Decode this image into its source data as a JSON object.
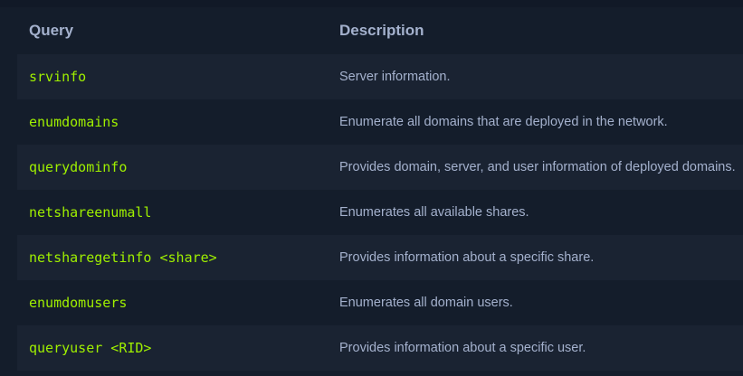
{
  "table": {
    "headers": {
      "query": "Query",
      "description": "Description"
    },
    "rows": [
      {
        "query": "srvinfo",
        "description": "Server information."
      },
      {
        "query": "enumdomains",
        "description": "Enumerate all domains that are deployed in the network."
      },
      {
        "query": "querydominfo",
        "description": "Provides domain, server, and user information of deployed domains."
      },
      {
        "query": "netshareenumall",
        "description": "Enumerates all available shares."
      },
      {
        "query": "netsharegetinfo <share>",
        "description": "Provides information about a specific share."
      },
      {
        "query": "enumdomusers",
        "description": "Enumerates all domain users."
      },
      {
        "query": "queryuser <RID>",
        "description": "Provides information about a specific user."
      }
    ]
  },
  "colors": {
    "background": "#141d2b",
    "row_alt": "#1a2332",
    "code_text": "#9fef00",
    "body_text": "#a4b1cd"
  }
}
